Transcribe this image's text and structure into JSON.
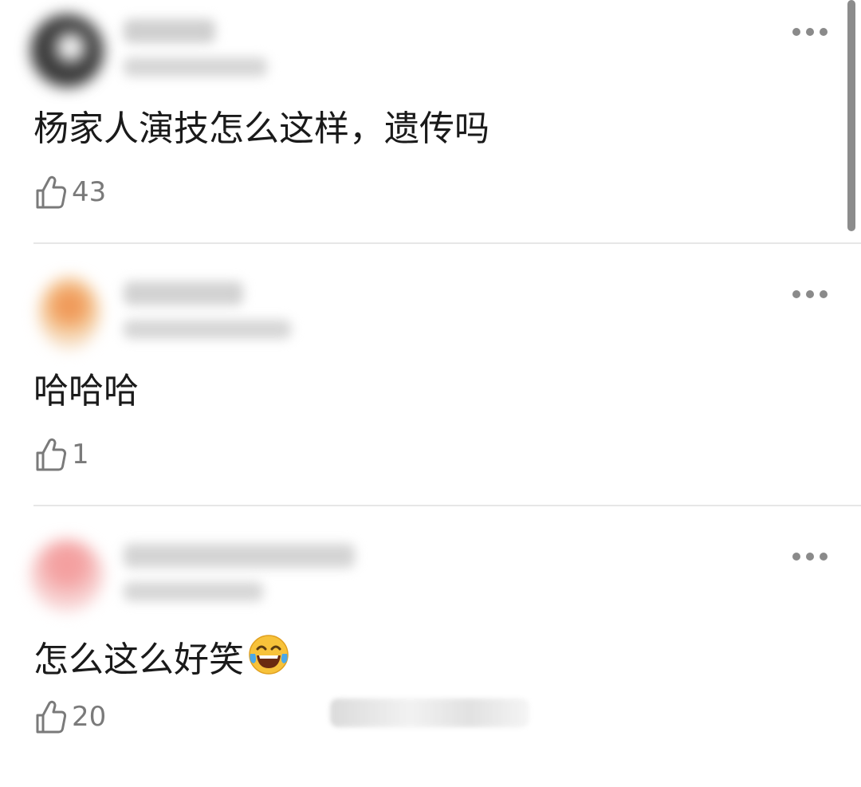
{
  "comments": [
    {
      "text": "杨家人演技怎么这样，遗传吗",
      "likes": "43",
      "avatar_color": "#3a3a3a",
      "name_color": "#cfcfcf"
    },
    {
      "text": "哈哈哈",
      "likes": "1",
      "avatar_color": "#e8a66a",
      "name_color": "#d2d2d2"
    },
    {
      "text": "怎么这么好笑",
      "likes": "20",
      "avatar_color": "#f2b8b8",
      "name_color": "#d4d4d4",
      "emoji": "face-with-tears-of-joy-icon"
    }
  ],
  "colors": {
    "text": "#1a1a1a",
    "meta": "#7a7a7a",
    "divider": "#e6e6e6",
    "scrollbar": "#8c8c8c"
  },
  "icons": {
    "like": "thumbs-up-outline-icon",
    "more": "more-dots-icon"
  }
}
